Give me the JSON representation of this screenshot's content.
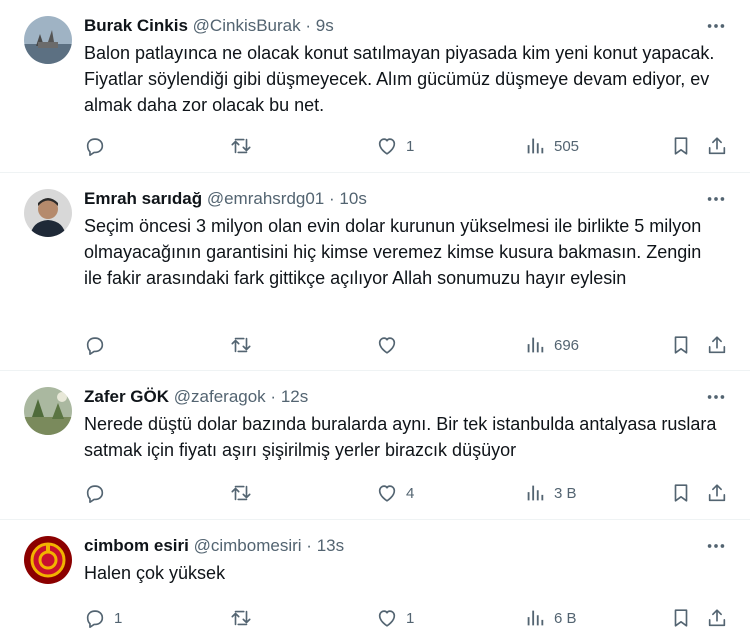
{
  "tweets": [
    {
      "name": "Burak Cinkis",
      "handle": "@CinkisBurak",
      "sep": "·",
      "time": "9s",
      "text": "Balon patlayınca ne olacak konut satılmayan piyasada kim yeni konut yapacak. Fiyatlar söylendiği gibi düşmeyecek. Alım gücümüz düşmeye devam ediyor, ev almak daha zor olacak bu net.",
      "replies": "",
      "retweets": "",
      "likes": "1",
      "views": "505"
    },
    {
      "name": "Emrah sarıdağ",
      "handle": "@emrahsrdg01",
      "sep": "·",
      "time": "10s",
      "text": "Seçim öncesi 3 milyon olan evin dolar kurunun yükselmesi ile birlikte 5 milyon olmayacağının garantisini hiç kimse veremez kimse kusura bakmasın. Zengin ile fakir arasındaki fark gittikçe açılıyor Allah sonumuzu hayır eylesin",
      "replies": "",
      "retweets": "",
      "likes": "",
      "views": "696"
    },
    {
      "name": "Zafer GÖK",
      "handle": "@zaferagok",
      "sep": "·",
      "time": "12s",
      "text": "Nerede düştü dolar bazında buralarda aynı. Bir tek istanbulda antalyasa ruslara satmak için fiyatı aşırı şişirilmiş yerler birazcık düşüyor",
      "replies": "",
      "retweets": "",
      "likes": "4",
      "views": "3 B"
    },
    {
      "name": "cimbom esiri",
      "handle": "@cimbomesiri",
      "sep": "·",
      "time": "13s",
      "text": "Halen çok yüksek",
      "replies": "1",
      "retweets": "",
      "likes": "1",
      "views": "6 B"
    }
  ],
  "colors": {
    "text": "#0f1419",
    "secondary": "#536471",
    "divider": "#eff3f4"
  },
  "icons": [
    "more-icon",
    "reply-icon",
    "retweet-icon",
    "like-icon",
    "views-icon",
    "bookmark-icon",
    "share-icon"
  ]
}
